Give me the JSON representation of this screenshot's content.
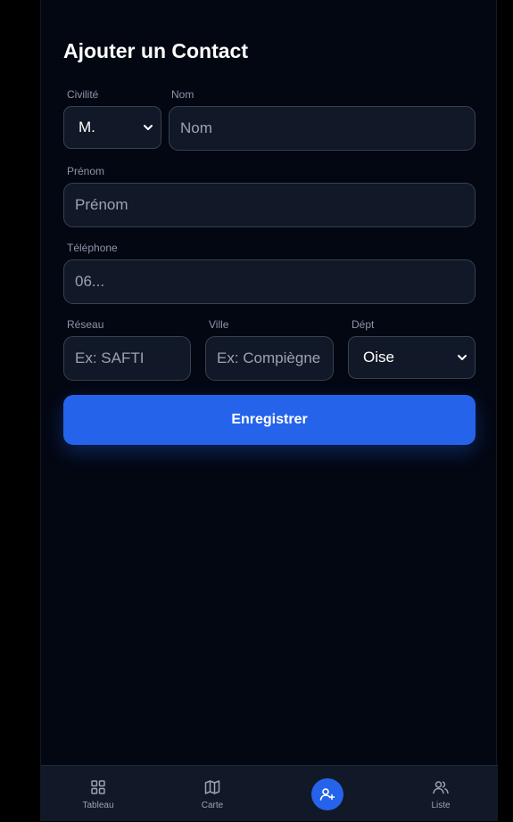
{
  "form": {
    "title": "Ajouter un Contact",
    "civilite": {
      "label": "Civilité",
      "value": "M."
    },
    "nom": {
      "label": "Nom",
      "placeholder": "Nom"
    },
    "prenom": {
      "label": "Prénom",
      "placeholder": "Prénom"
    },
    "telephone": {
      "label": "Téléphone",
      "placeholder": "06..."
    },
    "reseau": {
      "label": "Réseau",
      "placeholder": "Ex: SAFTI"
    },
    "ville": {
      "label": "Ville",
      "placeholder": "Ex: Compiègne"
    },
    "dept": {
      "label": "Dépt",
      "value": "Oise"
    },
    "submit_label": "Enregistrer"
  },
  "nav": {
    "items": [
      {
        "label": "Tableau",
        "icon": "grid-icon"
      },
      {
        "label": "Carte",
        "icon": "map-icon"
      },
      {
        "label": "",
        "icon": "user-plus-icon"
      },
      {
        "label": "Liste",
        "icon": "users-icon"
      }
    ]
  },
  "colors": {
    "background": "#030712",
    "surface": "#111827",
    "border": "#374151",
    "accent": "#2563eb",
    "text": "#ffffff",
    "muted": "#9ca3af"
  }
}
